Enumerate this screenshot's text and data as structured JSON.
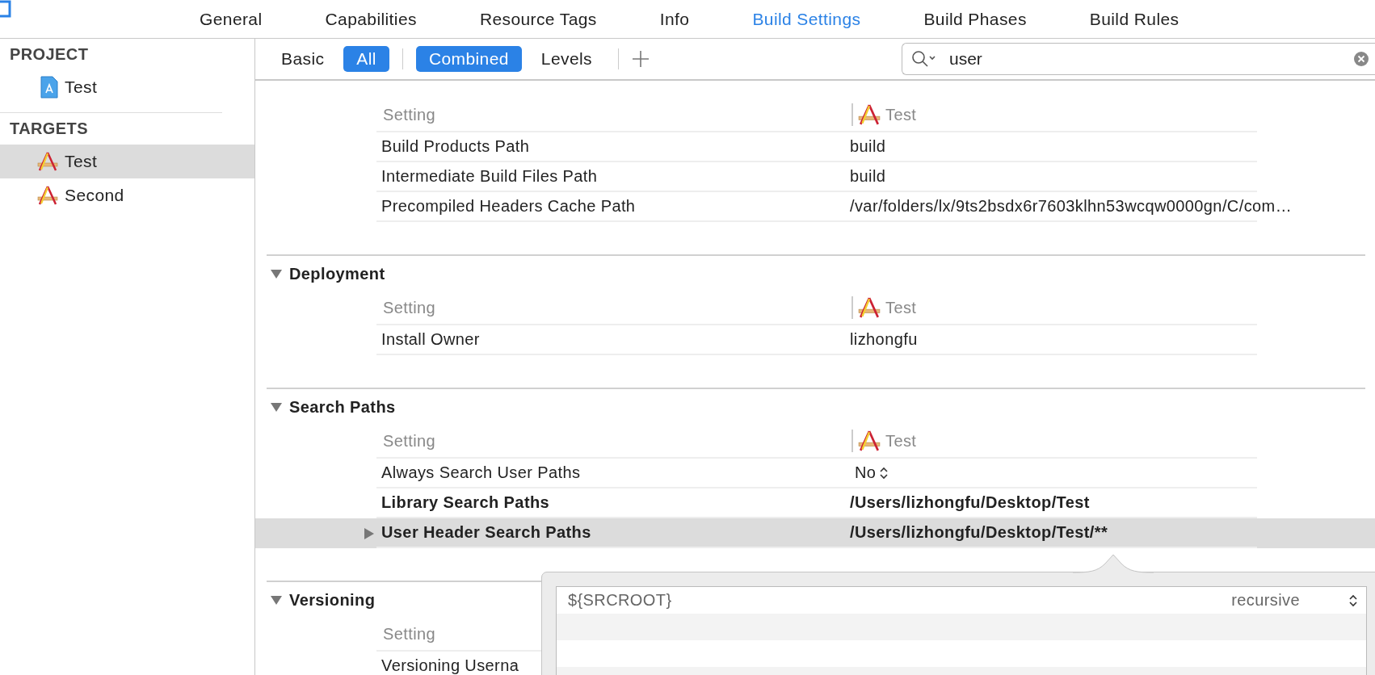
{
  "editor_tabs": [
    {
      "label": "General",
      "selected": false
    },
    {
      "label": "Capabilities",
      "selected": false
    },
    {
      "label": "Resource Tags",
      "selected": false
    },
    {
      "label": "Info",
      "selected": false
    },
    {
      "label": "Build Settings",
      "selected": true
    },
    {
      "label": "Build Phases",
      "selected": false
    },
    {
      "label": "Build Rules",
      "selected": false
    }
  ],
  "sidebar": {
    "groups": [
      {
        "title": "PROJECT",
        "items": [
          {
            "label": "Test",
            "kind": "project",
            "selected": false
          }
        ]
      },
      {
        "title": "TARGETS",
        "items": [
          {
            "label": "Test",
            "kind": "target",
            "selected": true
          },
          {
            "label": "Second",
            "kind": "target",
            "selected": false
          }
        ]
      }
    ]
  },
  "filter_bar": {
    "scope": [
      {
        "label": "Basic",
        "selected": false
      },
      {
        "label": "All",
        "selected": true
      }
    ],
    "view_mode": [
      {
        "label": "Combined",
        "selected": true
      },
      {
        "label": "Levels",
        "selected": false
      }
    ],
    "search": {
      "value": "user"
    }
  },
  "sections": [
    {
      "column_header": "Setting",
      "target_header": "Test",
      "rows": [
        {
          "name": "Build Products Path",
          "value": "build",
          "kind": "text",
          "modified": false,
          "selected": false
        },
        {
          "name": "Intermediate Build Files Path",
          "value": "build",
          "kind": "text",
          "modified": false,
          "selected": false
        },
        {
          "name": "Precompiled Headers Cache Path",
          "value": "/var/folders/lx/9ts2bsdx6r7603klhn53wcqw0000gn/C/com…",
          "kind": "text",
          "modified": false,
          "selected": false
        }
      ]
    },
    {
      "title": "Deployment",
      "expanded": true,
      "column_header": "Setting",
      "target_header": "Test",
      "rows": [
        {
          "name": "Install Owner",
          "value": "lizhongfu",
          "kind": "text",
          "modified": false,
          "selected": false
        }
      ]
    },
    {
      "title": "Search Paths",
      "expanded": true,
      "column_header": "Setting",
      "target_header": "Test",
      "rows": [
        {
          "name": "Always Search User Paths",
          "value": "No",
          "kind": "popup",
          "modified": false,
          "selected": false
        },
        {
          "name": "Library Search Paths",
          "value": "/Users/lizhongfu/Desktop/Test",
          "kind": "text",
          "modified": true,
          "selected": false
        },
        {
          "name": "User Header Search Paths",
          "value": "/Users/lizhongfu/Desktop/Test/**",
          "kind": "list",
          "modified": true,
          "selected": true
        }
      ]
    },
    {
      "title": "Versioning",
      "expanded": true,
      "column_header": "Setting",
      "rows": [
        {
          "name": "Versioning Userna",
          "kind": "text",
          "modified": false,
          "selected": false
        }
      ]
    }
  ],
  "path_popover": {
    "rows": [
      {
        "path": "${SRCROOT}",
        "mode": "recursive"
      }
    ]
  }
}
